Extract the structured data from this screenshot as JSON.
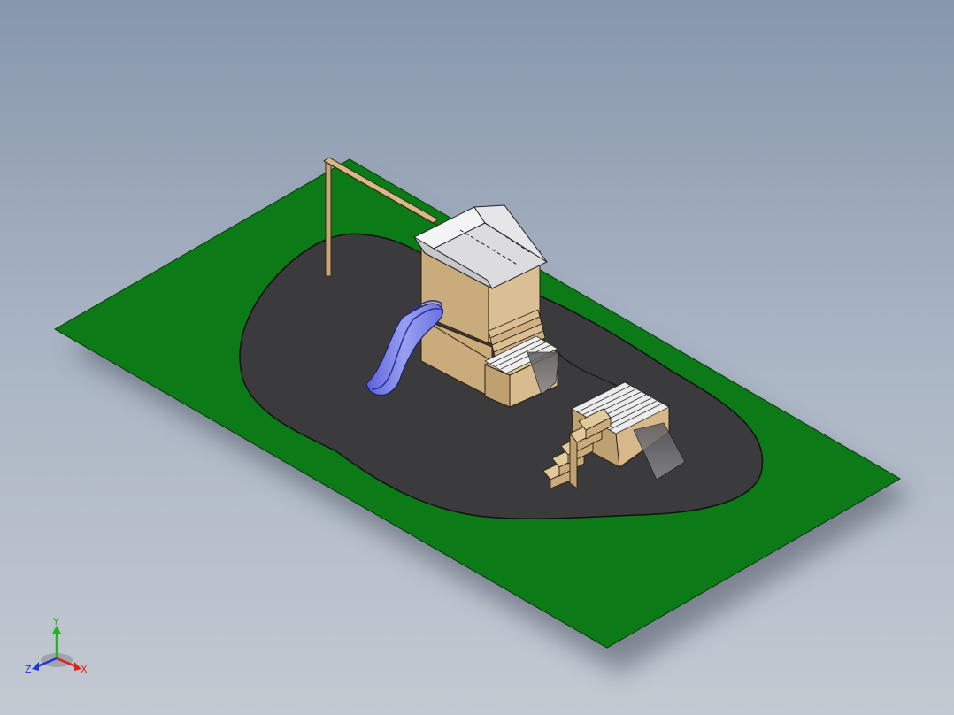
{
  "viewport": {
    "background_top": "#8797ac",
    "background_bottom": "#c3c9d1"
  },
  "model": {
    "ground_color": "#0d7a18",
    "asphalt_color": "#3b3b3e",
    "wood_color": "#c9ab7c",
    "roof_color": "#e9e9ec",
    "slide_color": "#7f86e6"
  },
  "triad": {
    "x_label": "X",
    "y_label": "Y",
    "z_label": "Z",
    "x_color": "#e0201a",
    "y_color": "#25b225",
    "z_color": "#2233dd"
  }
}
